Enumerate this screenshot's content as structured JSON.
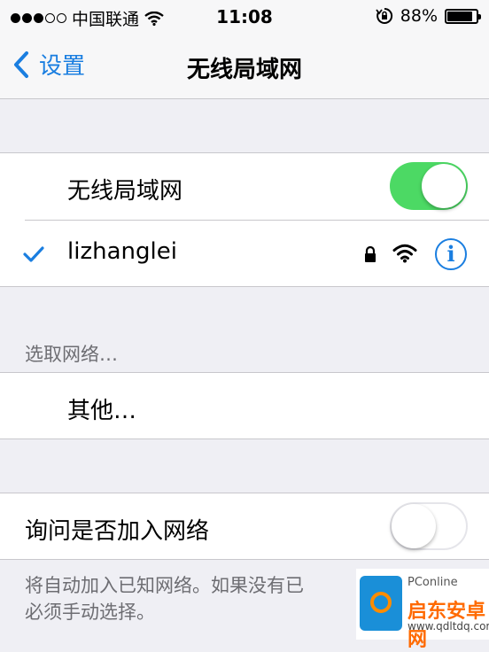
{
  "status_bar": {
    "carrier": "中国联通",
    "time": "11:08",
    "battery_text": "88%",
    "battery_level": 0.88
  },
  "nav": {
    "back_label": "设置",
    "title": "无线局域网"
  },
  "wifi_toggle": {
    "label": "无线局域网",
    "on": true
  },
  "connected_network": {
    "name": "lizhanglei",
    "secured": true
  },
  "choose_network": {
    "header": "选取网络…",
    "other_label": "其他…"
  },
  "ask_to_join": {
    "label": "询问是否加入网络",
    "on": false,
    "footer": "将自动加入已知网络。如果没有已知网络，您必须手动选择。",
    "footer_visible_line1": "将自动加入已知网络。如果没有已",
    "footer_visible_line2": "必须手动选择。"
  },
  "watermark": {
    "brand": "PConline",
    "name": "启东安卓网",
    "url": "www.qdltdq.com"
  },
  "colors": {
    "accent": "#1a7ee0",
    "toggle_on": "#4cd964",
    "background": "#efeff4"
  }
}
